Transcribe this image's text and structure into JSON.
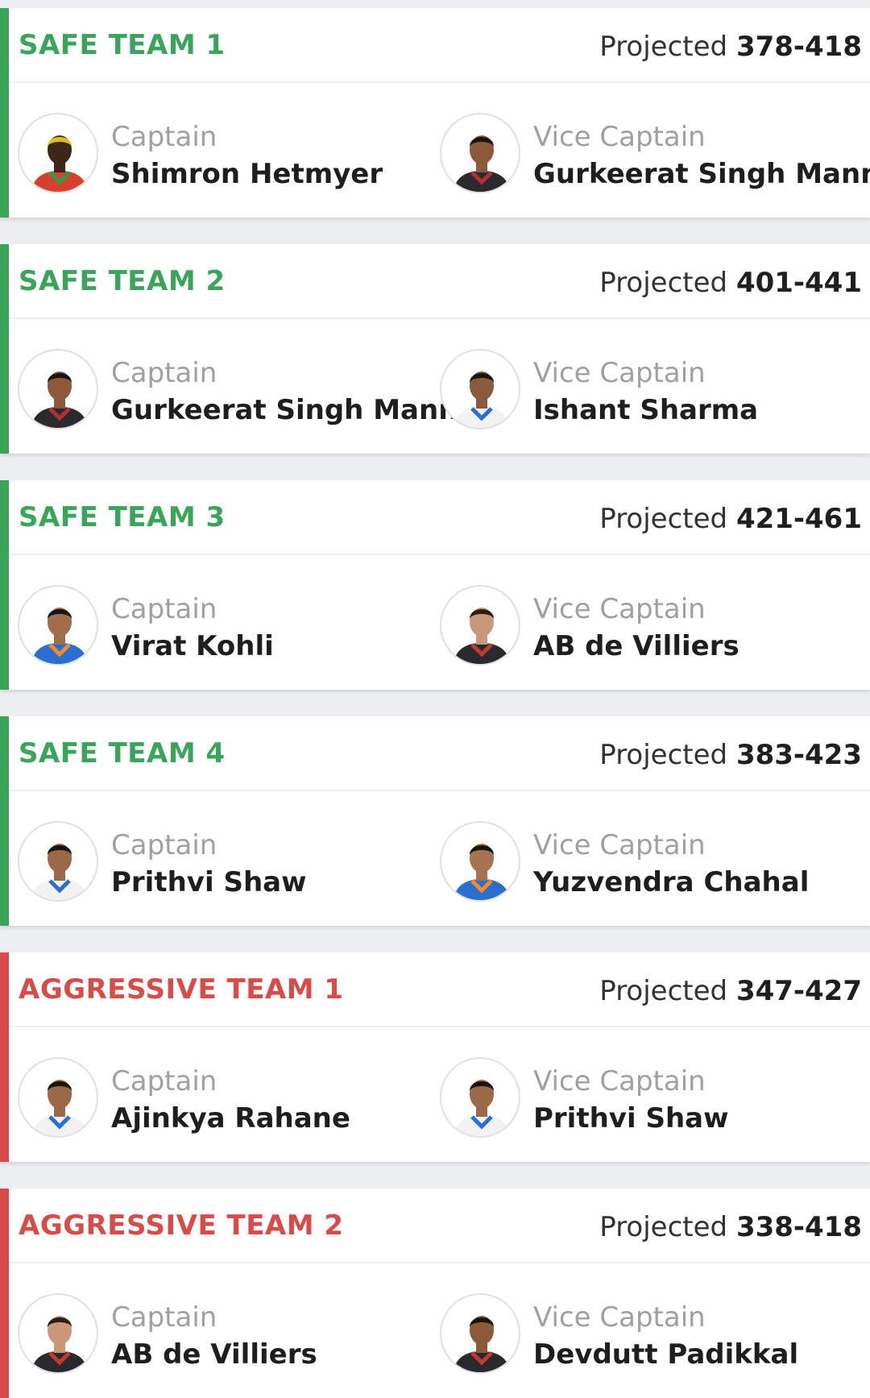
{
  "labels": {
    "projected": "Projected",
    "captain": "Captain",
    "vice_captain": "Vice Captain"
  },
  "colors": {
    "safe": "#3aa55a",
    "aggressive": "#d94b48"
  },
  "teams": [
    {
      "name": "SAFE TEAM 1",
      "kind": "safe",
      "projected": "378-418",
      "captain": {
        "name": "Shimron Hetmyer",
        "skin": "#3b2618",
        "hair": "#d8c21a",
        "shirt": "#d8402e",
        "shirt2": "#2e9a45"
      },
      "vice_captain": {
        "name": "Gurkeerat Singh Mann",
        "skin": "#8c5a3a",
        "hair": "#1a1410",
        "shirt": "#2a2a2e",
        "shirt2": "#b03030"
      }
    },
    {
      "name": "SAFE TEAM 2",
      "kind": "safe",
      "projected": "401-441",
      "captain": {
        "name": "Gurkeerat Singh Mann",
        "skin": "#8c5a3a",
        "hair": "#1a1410",
        "shirt": "#2a2a2e",
        "shirt2": "#b03030"
      },
      "vice_captain": {
        "name": "Ishant Sharma",
        "skin": "#8a5a3c",
        "hair": "#1a1410",
        "shirt": "#f2f2f2",
        "shirt2": "#2a6fd0"
      }
    },
    {
      "name": "SAFE TEAM 3",
      "kind": "safe",
      "projected": "421-461",
      "captain": {
        "name": "Virat Kohli",
        "skin": "#a06e4c",
        "hair": "#1a1410",
        "shirt": "#2a6fd0",
        "shirt2": "#f08a2c"
      },
      "vice_captain": {
        "name": "AB de Villiers",
        "skin": "#c9987a",
        "hair": "#2a1e16",
        "shirt": "#2a2a2e",
        "shirt2": "#c03a30"
      }
    },
    {
      "name": "SAFE TEAM 4",
      "kind": "safe",
      "projected": "383-423",
      "captain": {
        "name": "Prithvi Shaw",
        "skin": "#9a6a48",
        "hair": "#1a1410",
        "shirt": "#f2f2f2",
        "shirt2": "#2a6fd0"
      },
      "vice_captain": {
        "name": "Yuzvendra Chahal",
        "skin": "#a57252",
        "hair": "#1a1410",
        "shirt": "#2a6fd0",
        "shirt2": "#f08a2c"
      }
    },
    {
      "name": "AGGRESSIVE TEAM 1",
      "kind": "aggressive",
      "projected": "347-427",
      "captain": {
        "name": "Ajinkya Rahane",
        "skin": "#9a6a48",
        "hair": "#1a1410",
        "shirt": "#f2f2f2",
        "shirt2": "#2a6fd0"
      },
      "vice_captain": {
        "name": "Prithvi Shaw",
        "skin": "#9a6a48",
        "hair": "#1a1410",
        "shirt": "#f2f2f2",
        "shirt2": "#2a6fd0"
      }
    },
    {
      "name": "AGGRESSIVE TEAM 2",
      "kind": "aggressive",
      "projected": "338-418",
      "captain": {
        "name": "AB de Villiers",
        "skin": "#c9987a",
        "hair": "#2a1e16",
        "shirt": "#2a2a2e",
        "shirt2": "#c03a30"
      },
      "vice_captain": {
        "name": "Devdutt Padikkal",
        "skin": "#8c5a3a",
        "hair": "#1a1410",
        "shirt": "#2a2a2e",
        "shirt2": "#c03a30"
      }
    }
  ]
}
